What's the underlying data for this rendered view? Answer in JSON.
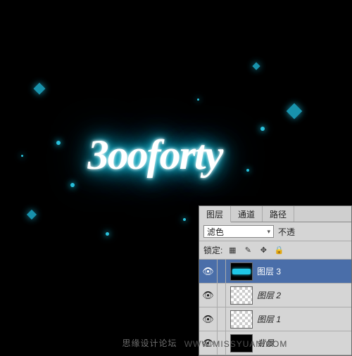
{
  "artwork_text": "3ooforty",
  "tabs": {
    "layers": "图层",
    "channels": "通道",
    "paths": "路径"
  },
  "blend_mode": "滤色",
  "opacity_label": "不透",
  "lock_label": "锁定:",
  "layers": [
    {
      "name": "图层 3",
      "visible": true,
      "selected": true,
      "thumb": "art"
    },
    {
      "name": "图层 2",
      "visible": true,
      "selected": false,
      "thumb": "checker"
    },
    {
      "name": "图层 1",
      "visible": true,
      "selected": false,
      "thumb": "checker"
    },
    {
      "name": "背景",
      "visible": true,
      "selected": false,
      "thumb": "black"
    }
  ],
  "watermark_left": "思缘设计论坛",
  "watermark_right": "WWW.MISSYUAN.COM"
}
